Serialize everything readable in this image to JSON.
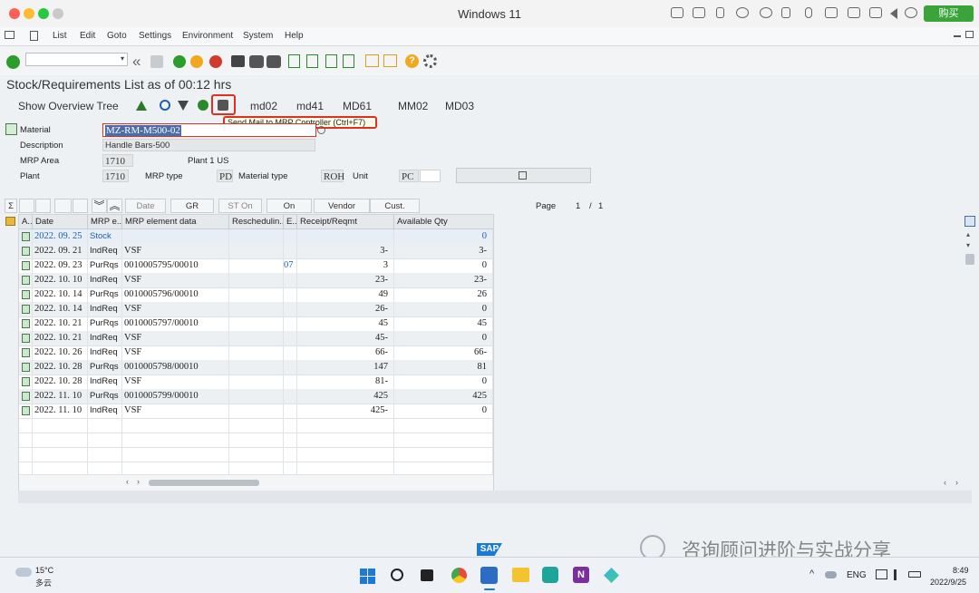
{
  "mac": {
    "title": "Windows 11",
    "buy_label": "购买"
  },
  "menu": [
    "List",
    "Edit",
    "Goto",
    "Settings",
    "Environment",
    "System",
    "Help"
  ],
  "screen": {
    "title": "Stock/Requirements List as of 00:12 hrs"
  },
  "app_toolbar": {
    "show_tree": "Show Overview Tree",
    "btn_md02": "md02",
    "btn_md41": "md41",
    "btn_md61": "MD61",
    "btn_mm02": "MM02",
    "btn_md03": "MD03"
  },
  "tooltip": "Send Mail to MRP Controller   (Ctrl+F7)",
  "header": {
    "material_label": "Material",
    "material_value": "MZ-RM-M500-02",
    "description_label": "Description",
    "description_value": "Handle Bars-500",
    "mrp_area_label": "MRP Area",
    "mrp_area_value": "1710",
    "mrp_area_text": "Plant 1 US",
    "plant_label": "Plant",
    "plant_value": "1710",
    "mrp_type_label": "MRP type",
    "mrp_type_value": "PD",
    "material_type_label": "Material type",
    "material_type_value": "ROH",
    "unit_label": "Unit",
    "unit_value": "PC"
  },
  "grid_toolbar": {
    "date": "Date",
    "gr": "GR",
    "st_on": "ST On",
    "on": "On",
    "vendor": "Vendor",
    "cust": "Cust.",
    "page_label": "Page",
    "page_current": "1",
    "page_sep": "/",
    "page_total": "1"
  },
  "columns": [
    "A..",
    "Date",
    "MRP e...",
    "MRP element data",
    "Reschedulin...",
    "E..",
    "Receipt/Reqmt",
    "Available Qty"
  ],
  "rows": [
    {
      "date": "2022. 09. 25",
      "elem": "Stock",
      "data": "",
      "resched": "",
      "e": "",
      "receipt": "",
      "avail": "0",
      "stock": true
    },
    {
      "date": "2022. 09. 21",
      "elem": "IndReq",
      "data": "VSF",
      "resched": "",
      "e": "",
      "receipt": "3-",
      "avail": "3-"
    },
    {
      "date": "2022. 09. 23",
      "elem": "PurRqs",
      "data": "0010005795/00010",
      "resched": "",
      "e": "07",
      "receipt": "3",
      "avail": "0"
    },
    {
      "date": "2022. 10. 10",
      "elem": "IndReq",
      "data": "VSF",
      "resched": "",
      "e": "",
      "receipt": "23-",
      "avail": "23-"
    },
    {
      "date": "2022. 10. 14",
      "elem": "PurRqs",
      "data": "0010005796/00010",
      "resched": "",
      "e": "",
      "receipt": "49",
      "avail": "26"
    },
    {
      "date": "2022. 10. 14",
      "elem": "IndReq",
      "data": "VSF",
      "resched": "",
      "e": "",
      "receipt": "26-",
      "avail": "0"
    },
    {
      "date": "2022. 10. 21",
      "elem": "PurRqs",
      "data": "0010005797/00010",
      "resched": "",
      "e": "",
      "receipt": "45",
      "avail": "45"
    },
    {
      "date": "2022. 10. 21",
      "elem": "IndReq",
      "data": "VSF",
      "resched": "",
      "e": "",
      "receipt": "45-",
      "avail": "0"
    },
    {
      "date": "2022. 10. 26",
      "elem": "IndReq",
      "data": "VSF",
      "resched": "",
      "e": "",
      "receipt": "66-",
      "avail": "66-"
    },
    {
      "date": "2022. 10. 28",
      "elem": "PurRqs",
      "data": "0010005798/00010",
      "resched": "",
      "e": "",
      "receipt": "147",
      "avail": "81"
    },
    {
      "date": "2022. 10. 28",
      "elem": "IndReq",
      "data": "VSF",
      "resched": "",
      "e": "",
      "receipt": "81-",
      "avail": "0"
    },
    {
      "date": "2022. 11. 10",
      "elem": "PurRqs",
      "data": "0010005799/00010",
      "resched": "",
      "e": "",
      "receipt": "425",
      "avail": "425"
    },
    {
      "date": "2022. 11. 10",
      "elem": "IndReq",
      "data": "VSF",
      "resched": "",
      "e": "",
      "receipt": "425-",
      "avail": "0"
    }
  ],
  "sap_logo": "SAP",
  "watermark": "咨询顾问进阶与实战分享",
  "taskbar": {
    "temp": "15°C",
    "weather": "多云",
    "lang": "ENG",
    "time": "8:49",
    "date": "2022/9/25"
  },
  "colors": {
    "accent_red": "#e03020",
    "link_blue": "#1f5fae",
    "ok_green": "#2a9d2a",
    "sap_blue": "#1a7bd6"
  }
}
